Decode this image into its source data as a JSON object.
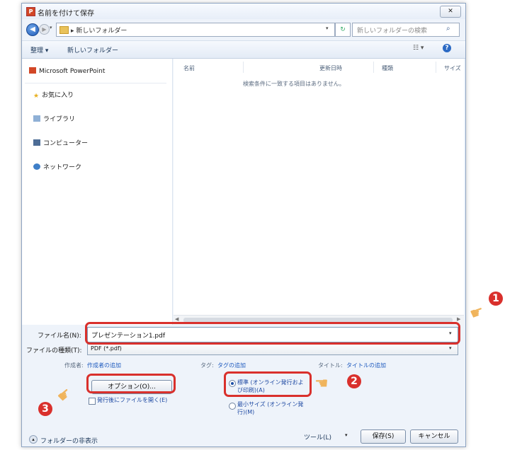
{
  "window": {
    "title": "名前を付けて保存",
    "close_label": "✕"
  },
  "address_bar": {
    "path": "▸ 新しいフォルダー",
    "search_placeholder": "新しいフォルダーの検索"
  },
  "toolbar": {
    "organize_label": "整理 ▾",
    "new_folder_label": "新しいフォルダー",
    "view_label": "☷ ▾"
  },
  "nav_pane": {
    "items": [
      {
        "label": "Microsoft PowerPoint",
        "icon": "powerpoint-icon"
      },
      {
        "label": "お気に入り",
        "icon": "star-icon"
      },
      {
        "label": "ライブラリ",
        "icon": "library-icon"
      },
      {
        "label": "コンピューター",
        "icon": "computer-icon"
      },
      {
        "label": "ネットワーク",
        "icon": "network-icon"
      }
    ]
  },
  "file_list": {
    "columns": [
      "名前",
      "更新日時",
      "種類",
      "サイズ"
    ],
    "empty_message": "検索条件に一致する項目はありません。"
  },
  "form": {
    "filename_label": "ファイル名(N):",
    "filename_value": "プレゼンテーション1.pdf",
    "filetype_label": "ファイルの種類(T):",
    "filetype_value": "PDF (*.pdf)",
    "author_label": "作成者:",
    "author_value": "作成者の追加",
    "tags_label": "タグ:",
    "tags_value": "タグの追加",
    "title_label": "タイトル:",
    "title_value": "タイトルの追加",
    "options_button": "オプション(O)...",
    "open_after_publish": "発行後にファイルを開く(E)",
    "optimize_standard": "標準 (オンライン発行および印刷)(A)",
    "optimize_minimum": "最小サイズ (オンライン発行)(M)",
    "hide_folders": "フォルダーの非表示",
    "tools_label": "ツール(L)",
    "save_button": "保存(S)",
    "cancel_button": "キャンセル"
  },
  "annotations": {
    "badge_1": "1",
    "badge_2": "2",
    "badge_3": "3",
    "highlight_color": "#d9302c"
  }
}
